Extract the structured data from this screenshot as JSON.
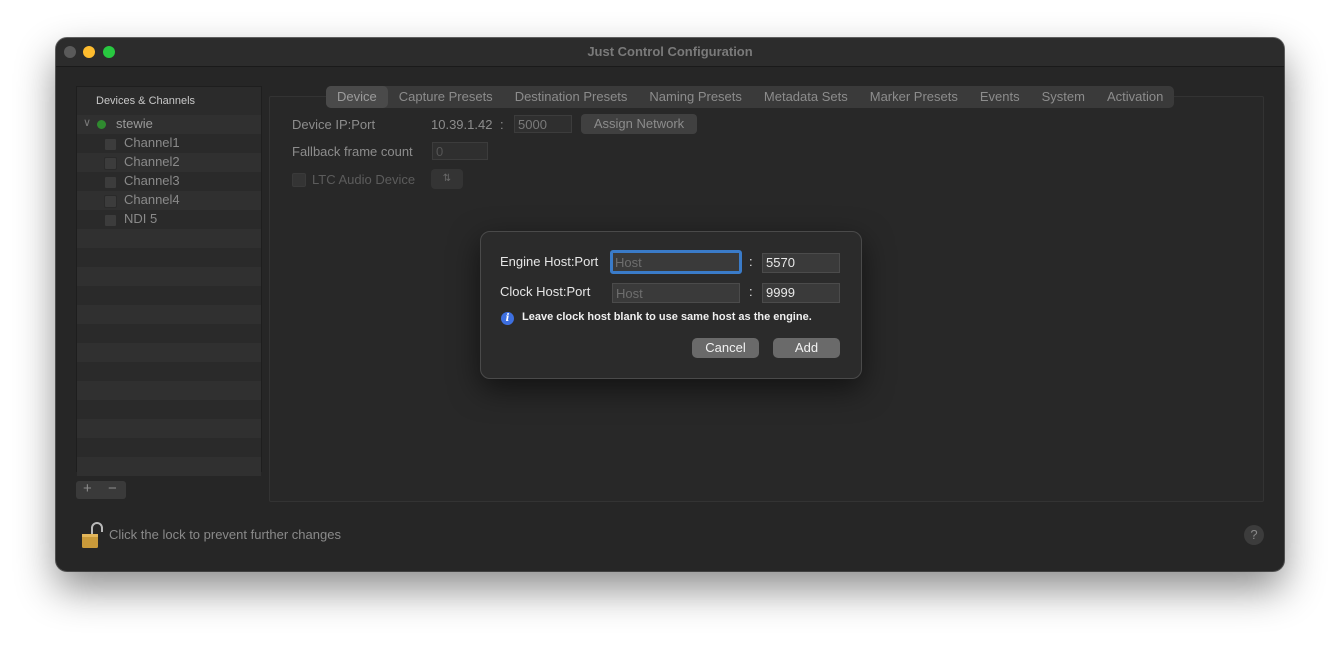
{
  "window": {
    "title": "Just Control Configuration"
  },
  "sidebar": {
    "header": "Devices & Channels",
    "device": {
      "name": "stewie",
      "status_color": "#2f8a2f"
    },
    "channels": [
      "Channel1",
      "Channel2",
      "Channel3",
      "Channel4",
      "NDI 5"
    ],
    "add_label": "+",
    "remove_label": "−"
  },
  "tabs": [
    "Device",
    "Capture Presets",
    "Destination Presets",
    "Naming Presets",
    "Metadata Sets",
    "Marker Presets",
    "Events",
    "System",
    "Activation"
  ],
  "active_tab": "Device",
  "device_tab": {
    "ip_port_label": "Device IP:Port",
    "ip_value": "10.39.1.42",
    "ip_colon": ":",
    "port_value": "5000",
    "assign_button": "Assign Network",
    "fallback_label": "Fallback frame count",
    "fallback_value": "0",
    "ltc_label": "LTC Audio Device"
  },
  "footer": {
    "lock_text": "Click the lock to prevent further changes",
    "help_label": "?"
  },
  "dialog": {
    "engine_label": "Engine Host:Port",
    "engine_host_placeholder": "Host",
    "engine_port": "5570",
    "clock_label": "Clock Host:Port",
    "clock_host_placeholder": "Host",
    "clock_port": "9999",
    "colon": ":",
    "info_text": "Leave clock host blank to use same host as the engine.",
    "cancel_label": "Cancel",
    "add_label": "Add"
  }
}
